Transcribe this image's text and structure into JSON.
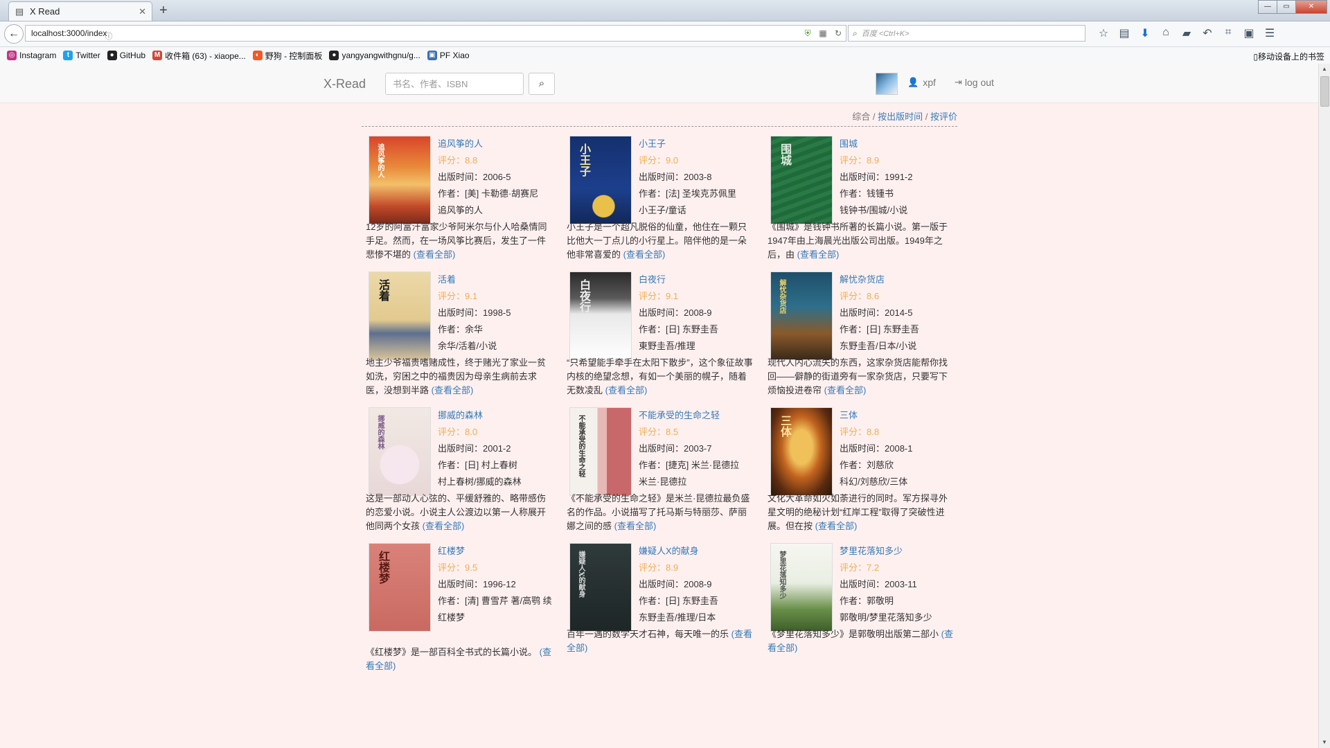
{
  "browser": {
    "tab_title": "X Read",
    "url": "localhost:3000/index",
    "search_placeholder": "百度 <Ctrl+K>",
    "bookmarks": [
      {
        "label": "Instagram",
        "color": "#c13584",
        "glyph": "◎"
      },
      {
        "label": "Twitter",
        "color": "#1da1f2",
        "glyph": "t"
      },
      {
        "label": "GitHub",
        "color": "#222222",
        "glyph": "●"
      },
      {
        "label": "收件箱 (63) - xiaope...",
        "color": "#d14836",
        "glyph": "M"
      },
      {
        "label": "野狗 - 控制面板",
        "color": "#f05a28",
        "glyph": "◐"
      },
      {
        "label": "yangyangwithgnu/g...",
        "color": "#222222",
        "glyph": "●"
      },
      {
        "label": "PF Xiao",
        "color": "#3b6fb6",
        "glyph": "▣"
      }
    ],
    "mobile_bookmarks": "移动设备上的书签"
  },
  "site": {
    "brand": "X-Read",
    "search_placeholder": "书名、作者、ISBN",
    "username": "xpf",
    "logout": "log out",
    "sort": {
      "all": "综合",
      "by_date": "按出版时间",
      "by_rating": "按评价"
    },
    "labels": {
      "rating": "评分：",
      "published": "出版时间：",
      "author": "作者：",
      "more": "(查看全部)"
    }
  },
  "books": [
    {
      "title": "追风筝的人",
      "rating": "8.8",
      "date": "2006-5",
      "author": "[美] 卡勒德·胡赛尼",
      "tags": "追风筝的人",
      "desc": "12岁的阿富汗富家少爷阿米尔与仆人哈桑情同手足。然而，在一场风筝比赛后，发生了一件悲惨不堪的",
      "cover": {
        "bg": "linear-gradient(180deg,#d9452a 0%,#e88a3a 35%,#f3c06a 55%,#c24a2a 80%,#7a2a1a 100%)",
        "text": "追风筝的人",
        "textcolor": "#fff"
      }
    },
    {
      "title": "小王子",
      "rating": "9.0",
      "date": "2003-8",
      "author": "[法] 圣埃克苏佩里",
      "tags": "小王子/童话",
      "desc": "小王子是一个超凡脱俗的仙童，他住在一颗只比他大一丁点儿的小行星上。陪伴他的是一朵他非常喜爱的",
      "cover": {
        "bg": "radial-gradient(circle at 55% 80%,#e8c04a 0 14%,transparent 15%),linear-gradient(180deg,#14306e,#1d3f8c 60%,#12285a)",
        "text": "小王子",
        "textcolor": "#f4e7a0"
      }
    },
    {
      "title": "围城",
      "rating": "8.9",
      "date": "1991-2",
      "author": "钱锺书",
      "tags": "钱钟书/围城/小说",
      "desc": "《围城》是钱钟书所著的长篇小说。第一版于1947年由上海晨光出版公司出版。1949年之后，由",
      "cover": {
        "bg": "repeating-linear-gradient(160deg,#1f6a3a 0 6px,#2a7a45 6px 12px)",
        "text": "围城",
        "textcolor": "#dfeee0"
      }
    },
    {
      "title": "活着",
      "rating": "9.1",
      "date": "1998-5",
      "author": "余华",
      "tags": "余华/活着/小说",
      "desc": "地主少爷福贵嗜赌成性，终于赌光了家业一贫如洗，穷困之中的福贵因为母亲生病前去求医，没想到半路",
      "cover": {
        "bg": "linear-gradient(180deg,#ecd9a8 0%,#e2c98f 55%,#5d6f8f 70%,#d9c39a 100%)",
        "text": "活着",
        "textcolor": "#1a1a1a"
      }
    },
    {
      "title": "白夜行",
      "rating": "9.1",
      "date": "2008-9",
      "author": "[日] 东野圭吾",
      "tags": "東野圭吾/推理",
      "desc": "“只希望能手牵手在太阳下散步”，这个象征故事内核的绝望念想，有如一个美丽的幌子，随着无数凌乱",
      "cover": {
        "bg": "linear-gradient(180deg,#2a2a2a 0%,#5a5a5a 30%,#e9e9e9 48%,#ffffff 100%)",
        "text": "白夜行",
        "textcolor": "#eee"
      }
    },
    {
      "title": "解忧杂货店",
      "rating": "8.6",
      "date": "2014-5",
      "author": "[日] 东野圭吾",
      "tags": "东野圭吾/日本/小说",
      "desc": "现代人内心流失的东西，这家杂货店能帮你找回——僻静的街道旁有一家杂货店，只要写下烦恼投进卷帘",
      "cover": {
        "bg": "linear-gradient(180deg,#1f4f6a 0%,#2e6f8a 40%,#8a5a2a 70%,#3a2a1a 100%)",
        "text": "解忧杂货店",
        "textcolor": "#f3d36a"
      }
    },
    {
      "title": "挪威的森林",
      "rating": "8.0",
      "date": "2001-2",
      "author": "[日] 村上春树",
      "tags": "村上春树/挪威的森林",
      "desc": "这是一部动人心弦的、平缓舒雅的、略带感伤的恋爱小说。小说主人公渡边以第一人称展开他同两个女孩",
      "cover": {
        "bg": "radial-gradient(circle at 50% 65%,#f6e6ee 0 30%,transparent 31%),linear-gradient(180deg,#f1e9e3,#e8d8d8)",
        "text": "挪威的森林",
        "textcolor": "#7a5a8a"
      }
    },
    {
      "title": "不能承受的生命之轻",
      "rating": "8.5",
      "date": "2003-7",
      "author": "[捷克] 米兰·昆德拉",
      "tags": "米兰·昆德拉",
      "desc": "《不能承受的生命之轻》是米兰·昆德拉最负盛名的作品。小说描写了托马斯与特丽莎、萨丽娜之间的感",
      "cover": {
        "bg": "linear-gradient(90deg,#f4f1ec 0 45%,#e7b9b6 45% 60%,#c9686a 60% 100%)",
        "text": "不能承受的生命之轻",
        "textcolor": "#333"
      }
    },
    {
      "title": "三体",
      "rating": "8.8",
      "date": "2008-1",
      "author": "刘慈欣",
      "tags": "科幻/刘慈欣/三体",
      "desc": "文化大革命如火如荼进行的同时。军方探寻外星文明的绝秘计划“红岸工程”取得了突破性进展。但在按",
      "cover": {
        "bg": "radial-gradient(ellipse at 50% 45%,#f0c05a 0 25%,#c2641f 45%,#5a2a10 75%,#2a1808 100%)",
        "text": "三体",
        "textcolor": "#f7e3a0"
      }
    },
    {
      "title": "红楼梦",
      "rating": "9.5",
      "date": "1996-12",
      "author": "[清] 曹雪芹 著/高鹗 续",
      "tags": "红楼梦",
      "desc": "《红楼梦》是一部百科全书式的长篇小说。",
      "cover": {
        "bg": "linear-gradient(180deg,#d9827a,#c96a62)",
        "text": "红楼梦",
        "textcolor": "#5a1a14"
      }
    },
    {
      "title": "嫌疑人X的献身",
      "rating": "8.9",
      "date": "2008-9",
      "author": "[日] 东野圭吾",
      "tags": "东野圭吾/推理/日本",
      "desc": "百年一遇的数学天才石神，每天唯一的乐",
      "cover": {
        "bg": "linear-gradient(180deg,#2f3a3a,#1e2626)",
        "text": "嫌疑人X的献身",
        "textcolor": "#d9d9d9"
      }
    },
    {
      "title": "梦里花落知多少",
      "rating": "7.2",
      "date": "2003-11",
      "author": "郭敬明",
      "tags": "郭敬明/梦里花落知多少",
      "desc": "《梦里花落知多少》是郭敬明出版第二部小",
      "cover": {
        "bg": "linear-gradient(180deg,#f6f6f2 0%,#e9eee2 45%,#6a8f4a 75%,#3e5f2a 100%)",
        "text": "梦里花落知多少",
        "textcolor": "#555"
      }
    }
  ]
}
